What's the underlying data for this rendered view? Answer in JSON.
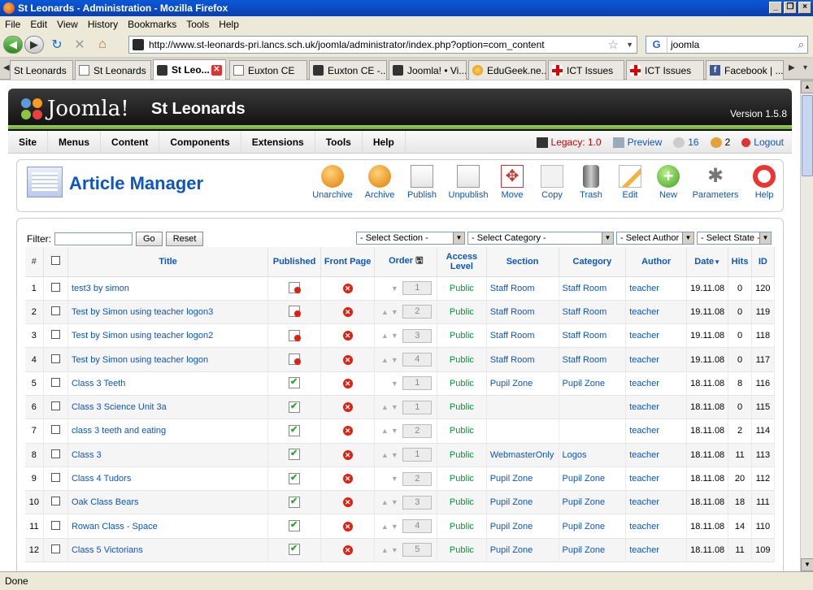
{
  "window": {
    "title": "St Leonards - Administration - Mozilla Firefox"
  },
  "menubar": [
    "File",
    "Edit",
    "View",
    "History",
    "Bookmarks",
    "Tools",
    "Help"
  ],
  "nav": {
    "url": "http://www.st-leonards-pri.lancs.sch.uk/joomla/administrator/index.php?option=com_content",
    "search": "joomla",
    "search_engine": "G"
  },
  "tabs": [
    "St Leonards",
    "St Leonards",
    "St Leo...",
    "Euxton CE",
    "Euxton CE -...",
    "Joomla! • Vi...",
    "EduGeek.ne...",
    "ICT Issues",
    "ICT Issues",
    "Facebook | ..."
  ],
  "status": "Done",
  "joomla": {
    "logo": "Joomla!",
    "site": "St Leonards",
    "version": "Version 1.5.8",
    "menu": [
      "Site",
      "Menus",
      "Content",
      "Components",
      "Extensions",
      "Tools",
      "Help"
    ],
    "legacy": "Legacy: 1.0",
    "preview": "Preview",
    "messages": "16",
    "users": "2",
    "logout": "Logout"
  },
  "toolbar": {
    "title": "Article Manager",
    "buttons": [
      "Unarchive",
      "Archive",
      "Publish",
      "Unpublish",
      "Move",
      "Copy",
      "Trash",
      "Edit",
      "New",
      "Parameters",
      "Help"
    ]
  },
  "filter": {
    "label": "Filter:",
    "go": "Go",
    "reset": "Reset",
    "section": "- Select Section -",
    "category": "- Select Category -",
    "author": "- Select Author -",
    "state": "- Select State -"
  },
  "columns": {
    "num": "#",
    "title": "Title",
    "published": "Published",
    "front": "Front Page",
    "order": "Order",
    "access": "Access Level",
    "section": "Section",
    "category": "Category",
    "author": "Author",
    "date": "Date",
    "hits": "Hits",
    "id": "ID"
  },
  "articles": [
    {
      "num": "1",
      "title": "test3 by simon",
      "published": false,
      "order": "1",
      "access": "Public",
      "section": "Staff Room",
      "category": "Staff Room",
      "author": "teacher",
      "date": "19.11.08",
      "hits": "0",
      "id": "120"
    },
    {
      "num": "2",
      "title": "Test by Simon using teacher logon3",
      "published": false,
      "order": "2",
      "access": "Public",
      "section": "Staff Room",
      "category": "Staff Room",
      "author": "teacher",
      "date": "19.11.08",
      "hits": "0",
      "id": "119"
    },
    {
      "num": "3",
      "title": "Test by Simon using teacher logon2",
      "published": false,
      "order": "3",
      "access": "Public",
      "section": "Staff Room",
      "category": "Staff Room",
      "author": "teacher",
      "date": "19.11.08",
      "hits": "0",
      "id": "118"
    },
    {
      "num": "4",
      "title": "Test by Simon using teacher logon",
      "published": false,
      "order": "4",
      "access": "Public",
      "section": "Staff Room",
      "category": "Staff Room",
      "author": "teacher",
      "date": "19.11.08",
      "hits": "0",
      "id": "117"
    },
    {
      "num": "5",
      "title": "Class 3 Teeth",
      "published": true,
      "order": "1",
      "access": "Public",
      "section": "Pupil Zone",
      "category": "Pupil Zone",
      "author": "teacher",
      "date": "18.11.08",
      "hits": "8",
      "id": "116"
    },
    {
      "num": "6",
      "title": "Class 3 Science Unit 3a",
      "published": true,
      "order": "1",
      "access": "Public",
      "section": "",
      "category": "",
      "author": "teacher",
      "date": "18.11.08",
      "hits": "0",
      "id": "115"
    },
    {
      "num": "7",
      "title": "class 3 teeth and eating",
      "published": true,
      "order": "2",
      "access": "Public",
      "section": "",
      "category": "",
      "author": "teacher",
      "date": "18.11.08",
      "hits": "2",
      "id": "114"
    },
    {
      "num": "8",
      "title": "Class 3",
      "published": true,
      "order": "1",
      "access": "Public",
      "section": "WebmasterOnly",
      "category": "Logos",
      "author": "teacher",
      "date": "18.11.08",
      "hits": "11",
      "id": "113"
    },
    {
      "num": "9",
      "title": "Class 4 Tudors",
      "published": true,
      "order": "2",
      "access": "Public",
      "section": "Pupil Zone",
      "category": "Pupil Zone",
      "author": "teacher",
      "date": "18.11.08",
      "hits": "20",
      "id": "112"
    },
    {
      "num": "10",
      "title": "Oak Class Bears",
      "published": true,
      "order": "3",
      "access": "Public",
      "section": "Pupil Zone",
      "category": "Pupil Zone",
      "author": "teacher",
      "date": "18.11.08",
      "hits": "18",
      "id": "111"
    },
    {
      "num": "11",
      "title": "Rowan Class - Space",
      "published": true,
      "order": "4",
      "access": "Public",
      "section": "Pupil Zone",
      "category": "Pupil Zone",
      "author": "teacher",
      "date": "18.11.08",
      "hits": "14",
      "id": "110"
    },
    {
      "num": "12",
      "title": "Class 5 Victorians",
      "published": true,
      "order": "5",
      "access": "Public",
      "section": "Pupil Zone",
      "category": "Pupil Zone",
      "author": "teacher",
      "date": "18.11.08",
      "hits": "11",
      "id": "109"
    }
  ]
}
